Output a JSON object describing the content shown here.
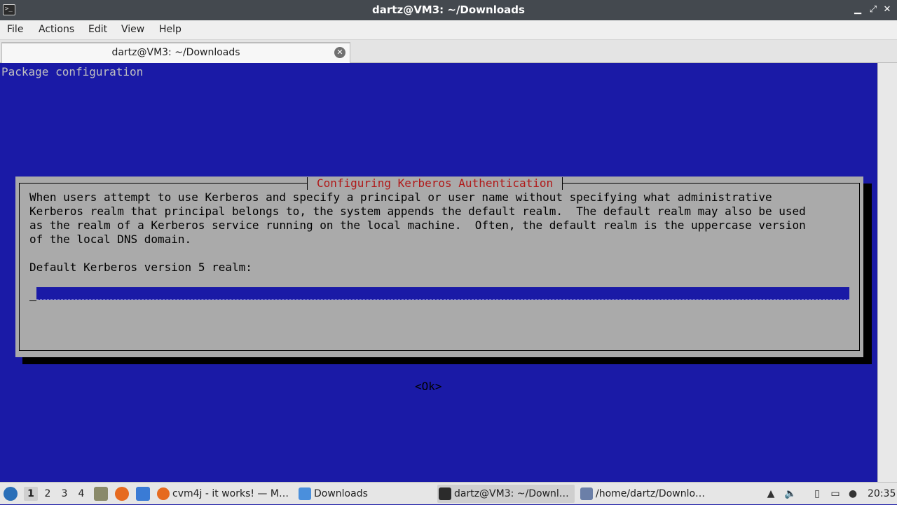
{
  "window": {
    "title": "dartz@VM3: ~/Downloads",
    "controls": {
      "minimize": "▁",
      "maximize": "⤢",
      "close": "✕"
    }
  },
  "menubar": {
    "items": [
      "File",
      "Actions",
      "Edit",
      "View",
      "Help"
    ]
  },
  "tabs": [
    {
      "label": "dartz@VM3: ~/Downloads",
      "close_icon": "✕"
    }
  ],
  "terminal": {
    "header": "Package configuration",
    "dialog": {
      "title": "Configuring Kerberos Authentication",
      "lines": [
        "When users attempt to use Kerberos and specify a principal or user name without specifying what administrative",
        "Kerberos realm that principal belongs to, the system appends the default realm.  The default realm may also be used",
        "as the realm of a Kerberos service running on the local machine.  Often, the default realm is the uppercase version",
        "of the local DNS domain."
      ],
      "prompt": "Default Kerberos version 5 realm:",
      "input_value": "",
      "ok_button": "<Ok>"
    }
  },
  "taskbar": {
    "workspaces": [
      "1",
      "2",
      "3",
      "4"
    ],
    "active_workspace": "1",
    "tasks": [
      {
        "label": "cvm4j - it works! — M…",
        "icon": "firefox-icon"
      },
      {
        "label": "Downloads",
        "icon": "folder-icon"
      },
      {
        "label": "dartz@VM3: ~/Downl…",
        "icon": "terminal-icon",
        "active": true
      },
      {
        "label": "/home/dartz/Downlo…",
        "icon": "text-editor-icon"
      }
    ],
    "clock": "20:35"
  },
  "colors": {
    "terminal_bg": "#1a1aa6",
    "dialog_bg": "#aaaaaa",
    "dialog_title": "#b01818",
    "titlebar_bg": "#44494f"
  }
}
